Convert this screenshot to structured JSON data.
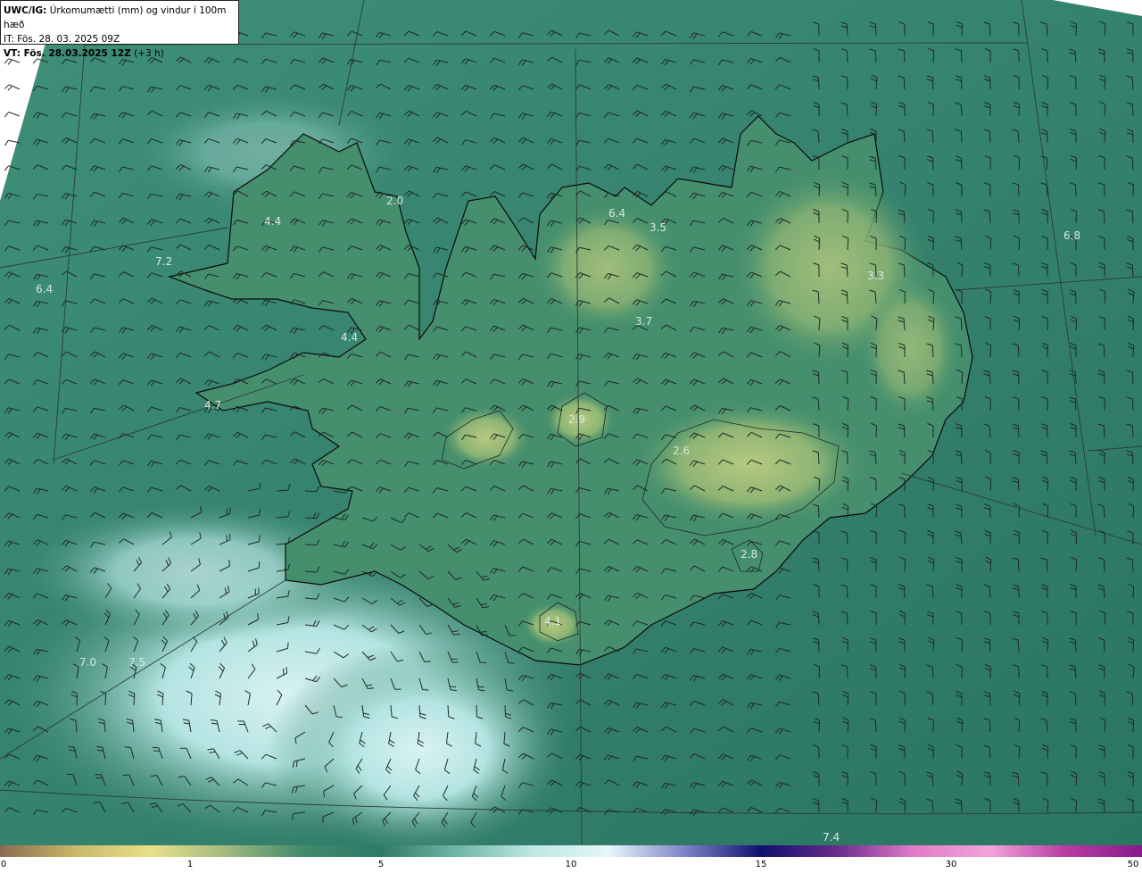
{
  "header": {
    "model_prefix": "UWC/IG:",
    "title": "Úrkomumætti (mm) og vindur í 100m hæð",
    "it_line": "IT: Fös. 28. 03. 2025 09Z",
    "vt_prefix": "VT: Fös. 28.03.2025 12Z",
    "vt_suffix": "(+3 h)"
  },
  "map_labels": [
    "4.4",
    "2.0",
    "6.4",
    "3.5",
    "6.8",
    "7.2",
    "6.4",
    "3.3",
    "3.7",
    "4.4",
    "4.7",
    "2.9",
    "2.6",
    "2.8",
    "4.1",
    "7.0",
    "7.5",
    "7.4"
  ],
  "colorbar": {
    "ticks": [
      "0",
      "1",
      "5",
      "10",
      "15",
      "30",
      "50"
    ],
    "colors": [
      "#8a6a4f",
      "#c9b96a",
      "#e8e08a",
      "#9fb77e",
      "#3f8a6c",
      "#2f7a66",
      "#6fb6a7",
      "#bfe7e6",
      "#e7f6fb",
      "#7d82c8",
      "#0f0f6e",
      "#6a2c8c",
      "#e37ac9",
      "#f2a4d9",
      "#b73ca3",
      "#8a1a8a"
    ]
  },
  "colors": {
    "sea": "#2f7a68",
    "land": "#3f8a6c",
    "highland": "#9fbe78",
    "wet_area": "#bfe7e6",
    "barb": "#1f2a26",
    "coast": "#0a0a0a"
  }
}
